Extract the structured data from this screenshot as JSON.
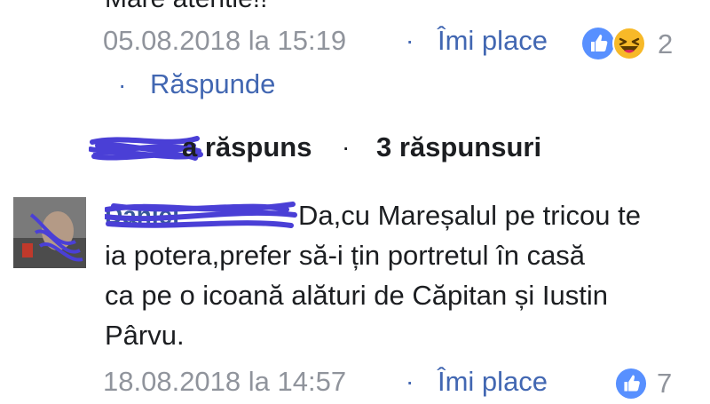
{
  "comment1": {
    "text_tail": "Mare atentie!!",
    "timestamp": "05.08.2018 la 15:19",
    "separator": "·",
    "like_label": "Îmi place",
    "reaction_count": "2",
    "reply_label": "Răspunde"
  },
  "replies_bar": {
    "replied_suffix": "a răspuns",
    "separator": "·",
    "replies_count_label": "3 răspunsuri"
  },
  "comment2": {
    "text": "Da,cu Mareșalul pe tricou te",
    "line2": "ia potera,prefer să-i țin portretul în casă",
    "line3": "ca pe o icoană alături de Căpitan și Iustin",
    "line4": "Pârvu.",
    "timestamp": "18.08.2018 la 14:57",
    "separator": "·",
    "like_label": "Îmi place",
    "reaction_count": "7"
  },
  "colors": {
    "link": "#4267b2",
    "meta": "#90949c",
    "text": "#1c1e21",
    "scribble": "#4a3fd6",
    "like_blue": "#5890ff",
    "haha_yellow": "#f7b928"
  },
  "icons": {
    "like": "like-icon",
    "haha": "haha-icon"
  }
}
